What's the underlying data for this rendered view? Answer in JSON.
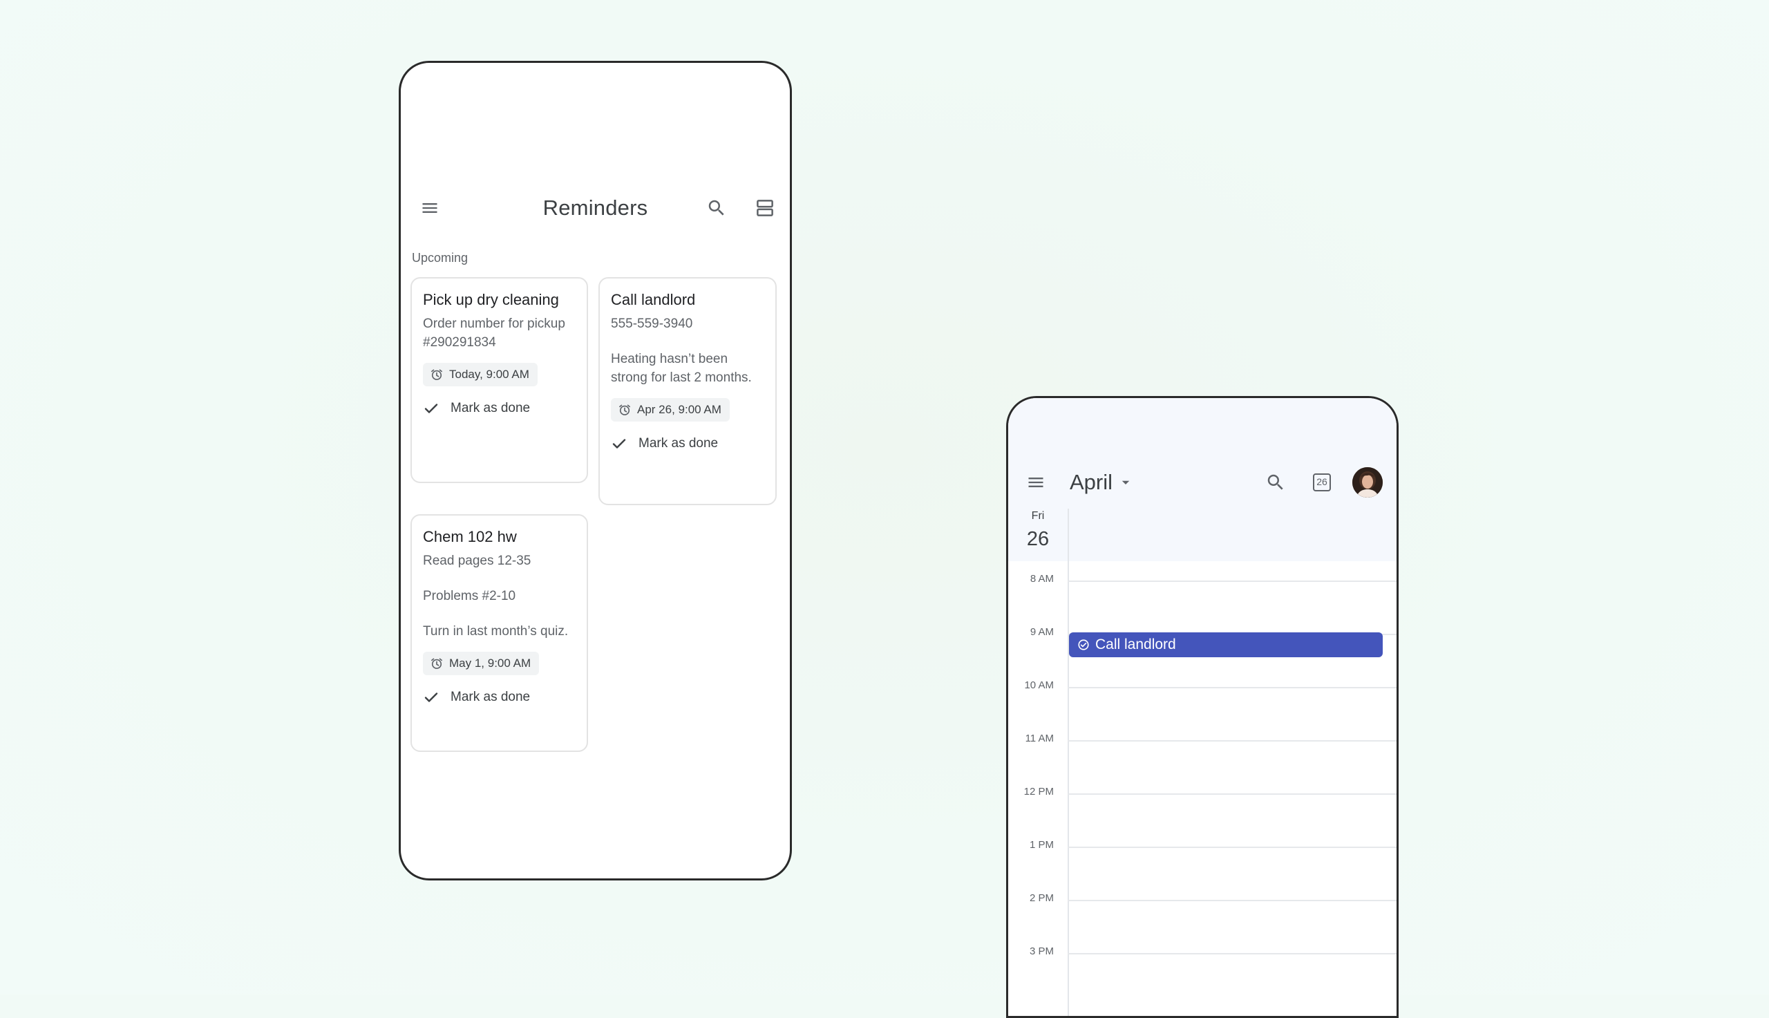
{
  "reminders": {
    "title": "Reminders",
    "section": "Upcoming",
    "cards": [
      {
        "title": "Pick up dry cleaning",
        "body": [
          "Order number for pickup #290291834"
        ],
        "time": "Today, 9:00 AM",
        "done_label": "Mark as done"
      },
      {
        "title": "Call landlord",
        "body": [
          "555-559-3940",
          "Heating hasn’t been strong for last 2 months."
        ],
        "time": "Apr 26, 9:00 AM",
        "done_label": "Mark as done"
      },
      {
        "title": "Chem 102 hw",
        "body": [
          "Read pages 12-35",
          "Problems #2-10",
          "Turn in last month’s quiz."
        ],
        "time": "May 1, 9:00 AM",
        "done_label": "Mark as done"
      }
    ]
  },
  "calendar": {
    "month": "April",
    "today_number": "26",
    "day_name": "Fri",
    "day_number": "26",
    "hours": [
      "8 AM",
      "9 AM",
      "10 AM",
      "11 AM",
      "12 PM",
      "1 PM",
      "2 PM",
      "3 PM"
    ],
    "event": {
      "title": "Call landlord",
      "color": "#4455bb"
    }
  },
  "colors": {
    "background": "#f1faf6",
    "event": "#4455bb",
    "text_primary": "#202124",
    "text_secondary": "#5f6368"
  },
  "icons": {
    "menu": "menu-icon",
    "search": "search-icon",
    "layout": "view-agenda-icon",
    "alarm": "alarm-icon",
    "check": "check-icon",
    "dropdown": "arrow-drop-down-icon",
    "today": "today-calendar-icon",
    "task": "task-check-circle-icon"
  }
}
